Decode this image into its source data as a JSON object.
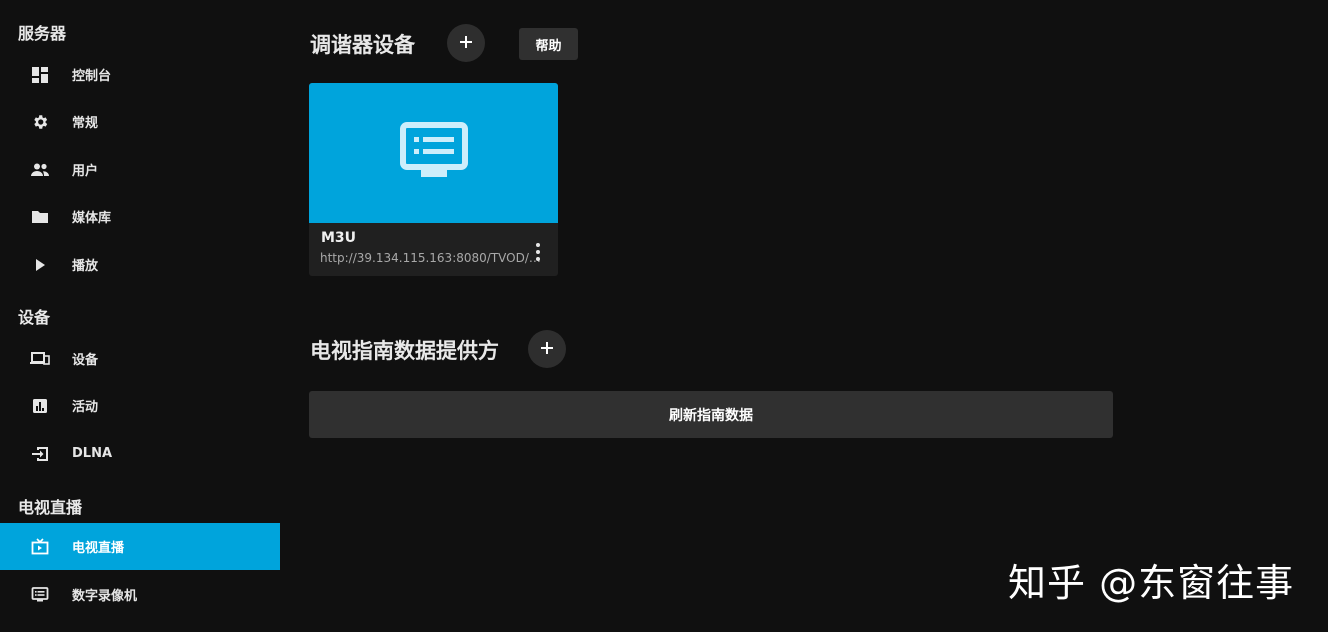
{
  "sidebar": {
    "sections": [
      {
        "title": "服务器",
        "items": [
          {
            "label": "控制台",
            "icon": "dashboard-icon"
          },
          {
            "label": "常规",
            "icon": "gear-icon"
          },
          {
            "label": "用户",
            "icon": "people-icon"
          },
          {
            "label": "媒体库",
            "icon": "folder-icon"
          },
          {
            "label": "播放",
            "icon": "play-icon"
          }
        ]
      },
      {
        "title": "设备",
        "items": [
          {
            "label": "设备",
            "icon": "devices-icon"
          },
          {
            "label": "活动",
            "icon": "bar-chart-icon"
          },
          {
            "label": "DLNA",
            "icon": "input-icon"
          }
        ]
      },
      {
        "title": "电视直播",
        "items": [
          {
            "label": "电视直播",
            "icon": "live-tv-icon",
            "active": true
          },
          {
            "label": "数字录像机",
            "icon": "dvr-icon"
          }
        ]
      }
    ]
  },
  "tuners": {
    "heading": "调谐器设备",
    "add_icon": "plus-icon",
    "help_label": "帮助",
    "devices": [
      {
        "name": "M3U",
        "url": "http://39.134.115.163:8080/TVOD/8...",
        "icon": "dvr-icon",
        "card_color": "#00a4dc"
      }
    ]
  },
  "guide": {
    "heading": "电视指南数据提供方",
    "add_icon": "plus-icon",
    "refresh_label": "刷新指南数据"
  },
  "watermark": "知乎 @东窗往事",
  "colors": {
    "accent": "#00a4dc",
    "background": "#101010",
    "button": "#303030"
  }
}
